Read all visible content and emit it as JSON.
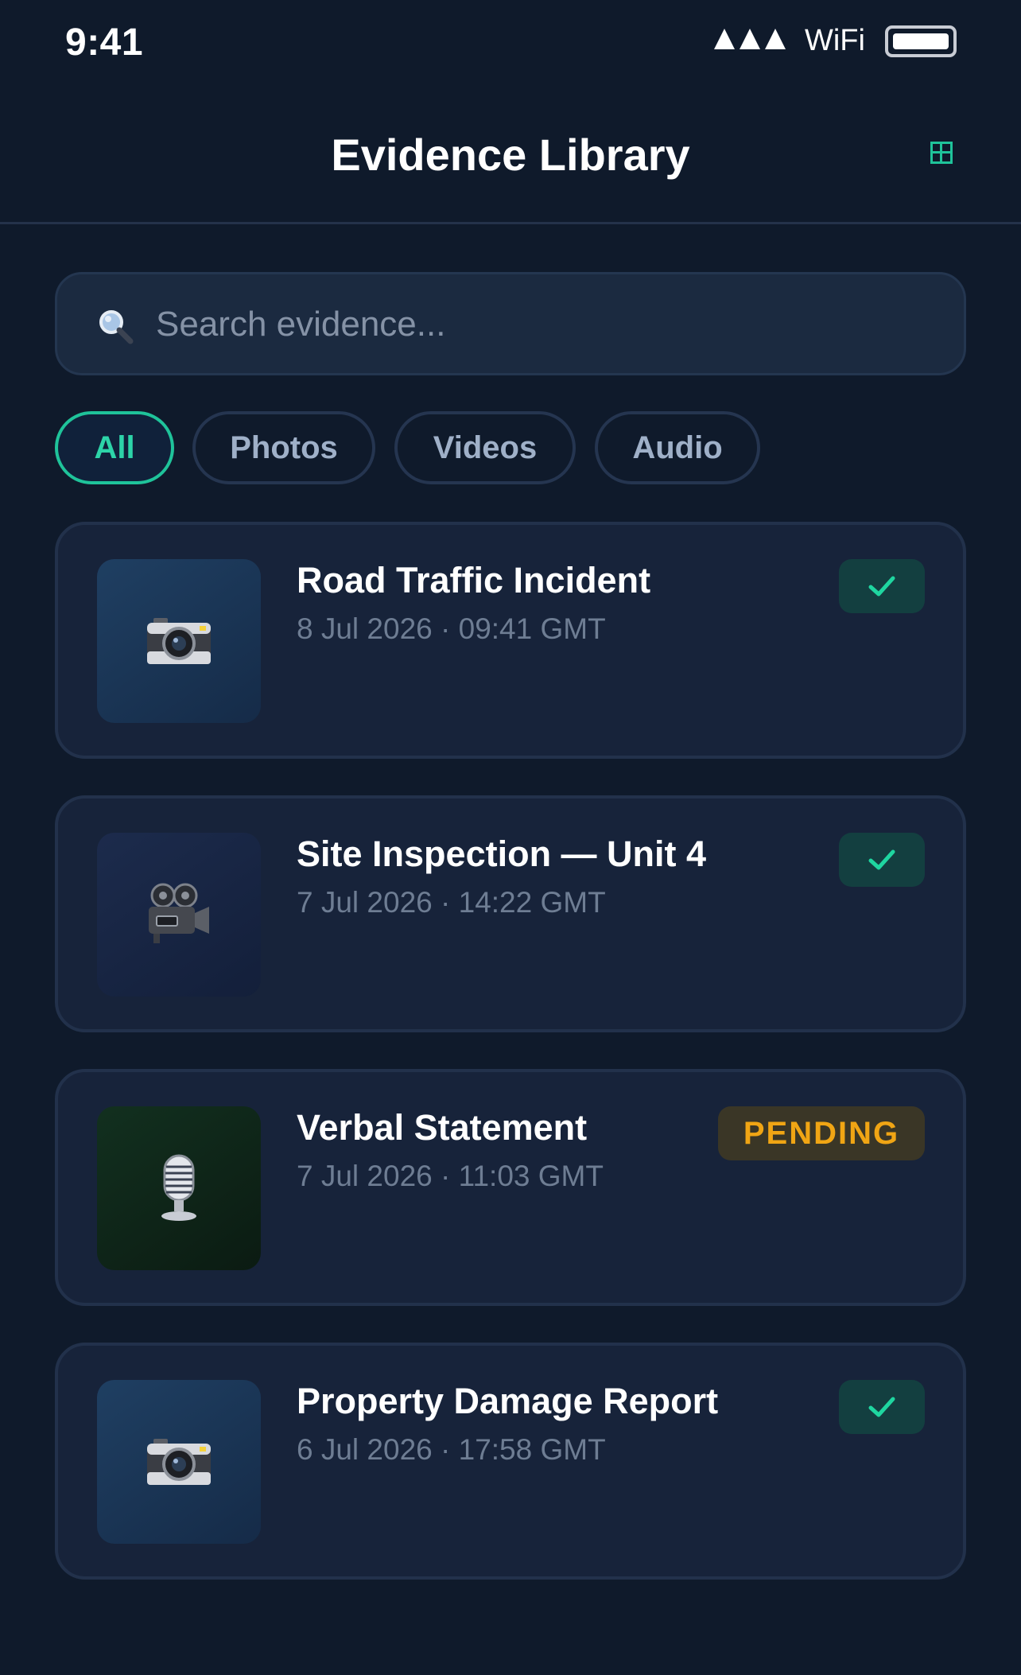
{
  "status_bar": {
    "time": "9:41",
    "wifi": "WiFi"
  },
  "header": {
    "title": "Evidence Library",
    "view_icon": "grid-icon"
  },
  "search": {
    "placeholder": "Search evidence..."
  },
  "filters": [
    {
      "label": "All",
      "active": true
    },
    {
      "label": "Photos",
      "active": false
    },
    {
      "label": "Videos",
      "active": false
    },
    {
      "label": "Audio",
      "active": false
    }
  ],
  "evidence": [
    {
      "title": "Road Traffic Incident",
      "date": "8 Jul 2026 · 09:41 GMT",
      "type": "photo",
      "icon": "camera-icon",
      "status": "verified"
    },
    {
      "title": "Site Inspection — Unit 4",
      "date": "7 Jul 2026 · 14:22 GMT",
      "type": "video",
      "icon": "video-camera-icon",
      "status": "verified"
    },
    {
      "title": "Verbal Statement",
      "date": "7 Jul 2026 · 11:03 GMT",
      "type": "audio",
      "icon": "microphone-icon",
      "status": "pending",
      "status_label": "PENDING"
    },
    {
      "title": "Property Damage Report",
      "date": "6 Jul 2026 · 17:58 GMT",
      "type": "photo",
      "icon": "camera-icon",
      "status": "verified"
    }
  ],
  "colors": {
    "background": "#0f1a2b",
    "card": "#17233a",
    "accent": "#1fc39a",
    "pending": "#f0a514"
  }
}
